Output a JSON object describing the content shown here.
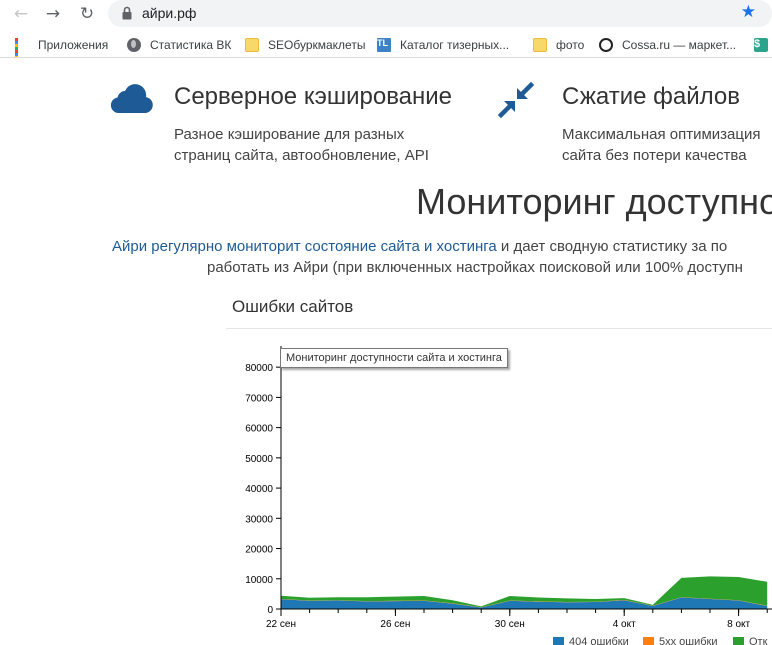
{
  "browser": {
    "url": "айри.рф",
    "bookmarks": [
      {
        "label": "Приложения",
        "icon": "apps-grid-icon"
      },
      {
        "label": "Статистика ВК",
        "icon": "globe-icon"
      },
      {
        "label": "SEOбуркмаклеты",
        "icon": "folder-icon"
      },
      {
        "label": "Каталог тизерных...",
        "icon": "tl-favicon-icon",
        "icon_text": "TL"
      },
      {
        "label": "фото",
        "icon": "folder-icon"
      },
      {
        "label": "Cossa.ru — маркет...",
        "icon": "cossa-favicon-icon"
      },
      {
        "label": "",
        "icon": "dollar-favicon-icon",
        "icon_text": "$"
      }
    ]
  },
  "features": [
    {
      "title": "Серверное кэширование",
      "desc_lines": [
        "Разное кэширование для разных",
        "страниц сайта, автообновление, API"
      ],
      "icon": "cloud-icon",
      "icon_color": "#1e5a96"
    },
    {
      "title": "Сжатие файлов",
      "desc_lines": [
        "Максимальная оптимизация",
        "сайта без потери качества"
      ],
      "icon": "compress-arrows-icon",
      "icon_color": "#1e5a96"
    }
  ],
  "monitoring": {
    "title": "Мониторинг доступно",
    "intro_link": "Айри регулярно мониторит состояние сайта и хостинга",
    "intro_rest": " и дает сводную статистику за по",
    "intro_line2": "работать из Айри (при включенных настройках поисковой или 100% доступн",
    "panel_title": "Ошибки сайтов",
    "tooltip": "Мониторинг доступности сайта и хостинга"
  },
  "chart_data": {
    "type": "area",
    "stacked": true,
    "yticks": [
      0,
      10000,
      20000,
      30000,
      40000,
      50000,
      60000,
      70000,
      80000
    ],
    "ylim": [
      0,
      87000
    ],
    "xticks": [
      "22 сен",
      "26 сен",
      "30 сен",
      "4 окт",
      "8 окт"
    ],
    "x": [
      "22 сен",
      "23 сен",
      "24 сен",
      "25 сен",
      "26 сен",
      "27 сен",
      "28 сен",
      "29 сен",
      "30 сен",
      "1 окт",
      "2 окт",
      "3 окт",
      "4 окт",
      "5 окт",
      "6 окт",
      "7 окт",
      "8 окт",
      "9 окт"
    ],
    "series": [
      {
        "name": "404 ошибки",
        "color": "#1f77b4",
        "values": [
          3200,
          2700,
          2800,
          2500,
          2600,
          2700,
          1800,
          500,
          2700,
          2400,
          2200,
          2300,
          2900,
          1000,
          3800,
          3300,
          2800,
          1000
        ]
      },
      {
        "name": "5хх ошибки",
        "color": "#ff7f0e",
        "values": [
          100,
          100,
          100,
          100,
          100,
          100,
          100,
          50,
          100,
          100,
          100,
          100,
          100,
          50,
          100,
          100,
          100,
          100
        ]
      },
      {
        "name": "Отк",
        "color": "#2ca02c",
        "values": [
          1100,
          900,
          1000,
          1300,
          1400,
          1500,
          1000,
          300,
          1500,
          1300,
          1200,
          900,
          600,
          300,
          6400,
          7400,
          7700,
          7900
        ]
      }
    ]
  }
}
